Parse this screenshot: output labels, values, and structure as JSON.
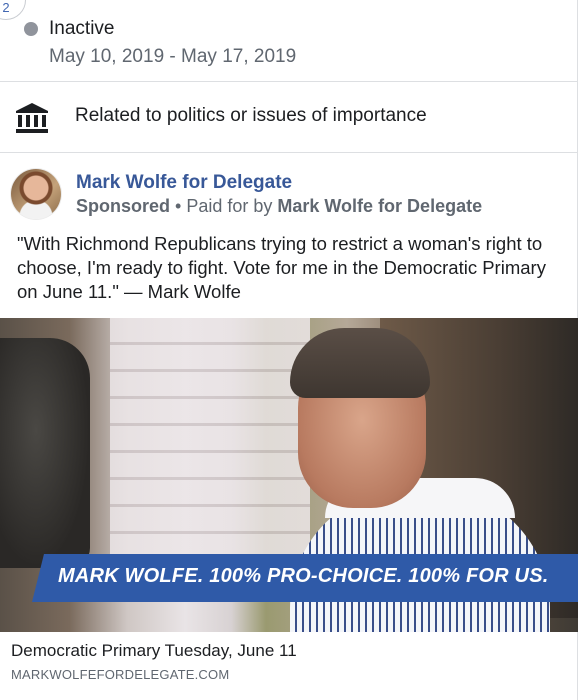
{
  "corner_badge": "2",
  "status": {
    "label": "Inactive",
    "date_range": "May 10, 2019 - May 17, 2019",
    "dot_color": "#90949c"
  },
  "category": {
    "icon": "bank-icon",
    "label": "Related to politics or issues of importance"
  },
  "post": {
    "page_name": "Mark Wolfe for Delegate",
    "sponsored": "Sponsored",
    "separator": " • ",
    "paid_for_prefix": "Paid for by ",
    "paid_for_by": "Mark Wolfe for Delegate",
    "text": "\"With Richmond Republicans trying to restrict a woman's right to choose, I'm ready to fight. Vote for me in the Democratic Primary on June 11.\" — Mark Wolfe",
    "image_banner_text": "MARK WOLFE. 100% PRO-CHOICE. 100% FOR US.",
    "link_caption": "Democratic Primary Tuesday, June 11",
    "link_url": "MARKWOLFEFORDELEGATE.COM"
  },
  "colors": {
    "link_blue": "#385898",
    "banner_blue": "#2f5aa8",
    "secondary_text": "#606770"
  }
}
